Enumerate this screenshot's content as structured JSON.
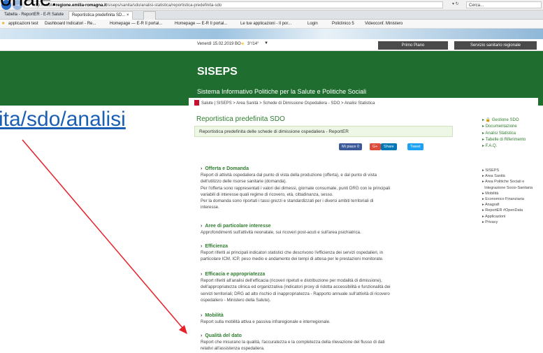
{
  "browser": {
    "url_prefix": "http://salute.",
    "url_domain": "regione.emilia-romagna.it",
    "url_path": "/siseps/sanita/sdo/analisi-statistica/reportistica-predefinita-sdo",
    "search_placeholder": "Cerca...",
    "tabs": [
      {
        "label": "Tabella - ReportER - E-R Salute"
      },
      {
        "label": "Reportistica predefinita SD..."
      }
    ],
    "favorites": [
      {
        "label": "applicazioni test"
      },
      {
        "label": "Dashboard Indicatori - Re..."
      },
      {
        "label": "Homepage — E-R Il portal..."
      },
      {
        "label": "Homepage — E-R Il portal..."
      },
      {
        "label": "Le tue applicazioni - Il por..."
      },
      {
        "label": "Login"
      },
      {
        "label": "Policlinico 5"
      },
      {
        "label": "Videoconf. Ministero"
      }
    ]
  },
  "overlay": {
    "top_text": "onale:",
    "link_text": "ita/sdo/analisi"
  },
  "topbar": {
    "date_text": "Venerdì 15.02.2019  BO",
    "weather": "3°/14°",
    "btn_primo": "Primo Piano",
    "btn_servizio": "Servizio sanitario regionale"
  },
  "header": {
    "title": "SISEPS",
    "subtitle": "Sistema Informativo Politiche per la Salute e Politiche Sociali"
  },
  "breadcrumb": "Salute | SISEPS > Area Sanità > Schede di Dimissione Ospedaliera - SDO > Analisi Statistica",
  "page": {
    "title": "Reportistica predefinita SDO",
    "intro": "Reportistica predefinita delle schede di dimissione ospedaliera - ReportER"
  },
  "social": {
    "like": "Mi piace 0",
    "gplus": "G+",
    "share": "Share",
    "tweet": "Tweet"
  },
  "sections": [
    {
      "title": "Offerta e Domanda",
      "lines": [
        "Report di attività ospedaliera dal punto di vista della produzione (offerta), e dal punto di vista",
        "dell'utilizzo delle risorse sanitarie (domanda).",
        "Per l'offerta sono rappresentati i valori dei dimessi, giornate consumate, punti DRG con le principali",
        "variabili di interesse quali regime di ricovero, età, cittadinanza, sesso.",
        "Per la domanda sono riportati i tassi grezzi e standardizzati per i diversi ambiti territoriali di",
        "interesse."
      ]
    },
    {
      "title": "Aree di particolare interesse",
      "lines": [
        "Approfondimenti sull'attività neonatale, sui ricoveri post-acuti e sull'area psichiatrica."
      ]
    },
    {
      "title": "Efficienza",
      "lines": [
        "Report riferiti ai principali indicatori statistici che descrivono l'efficienza dei servizi ospedalieri, in",
        "particolare ICM, ICP, peso medio e andamento dei tempi di attesa per le prestazioni monitorate."
      ]
    },
    {
      "title": "Efficacia e appropriatezza",
      "lines": [
        "Report riferiti all'analisi dell'efficacia (ricoveri ripetuti e distribuzione per modalità di dimissione),",
        "dell'appropriatezza clinica ed organizzativa (indicatori proxy di ridotta accessibilità e funzionalità dei",
        "servizi territoriali; DRG ad alto rischio di inappropriatezza - Rapporto annuale sull'attività di ricovero",
        "ospedaliero - Ministero della Salute)."
      ]
    },
    {
      "title": "Mobilità",
      "lines": [
        "Report sulla mobilità attiva e passiva infraregionale e interregionale."
      ]
    },
    {
      "title": "Qualità del dato",
      "lines": [
        "Report che misurano la qualità, l'accuratezza e la completezza della rilevazione del flusso di dati",
        "relativi all'assistenza ospedaliera."
      ]
    }
  ],
  "right_menu": {
    "items": [
      "Gestione SDO",
      "Documentazione",
      "Analisi Statistica",
      "Tabelle di Riferimento",
      "F.A.Q."
    ],
    "links": [
      "SISEPS",
      "Area Sanità",
      "Area Politiche Sociali e",
      "Integrazione Socio-Sanitaria",
      "Mobilità",
      "Economico Finanziaria",
      "Anagrafi",
      "ReportER #OpenData",
      "Applicazioni",
      "Privacy"
    ]
  },
  "colors": {
    "header_green": "#1f6e2f",
    "title_green": "#2f7d2f",
    "arrow_red": "#e8202a"
  }
}
